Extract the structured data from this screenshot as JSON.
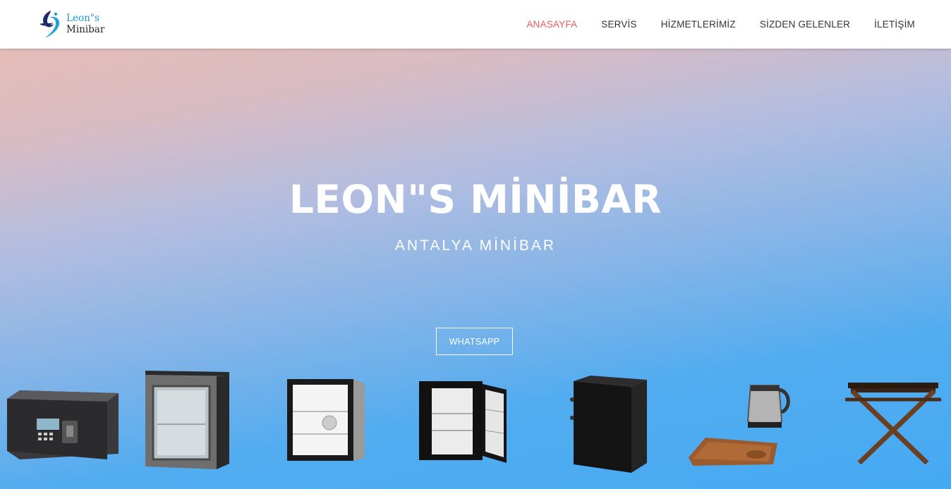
{
  "brand": {
    "line1": "Leon\"s",
    "line2": "Minibar"
  },
  "nav": {
    "items": [
      {
        "label": "ANASAYFA",
        "active": true
      },
      {
        "label": "SERVİS",
        "active": false
      },
      {
        "label": "HİZMETLERİMİZ",
        "active": false
      },
      {
        "label": "SİZDEN GELENLER",
        "active": false
      },
      {
        "label": "İLETİŞİM",
        "active": false
      }
    ]
  },
  "hero": {
    "title": "LEON\"S MİNİBAR",
    "subtitle": "ANTALYA MİNİBAR",
    "button_label": "WHATSAPP"
  },
  "colors": {
    "accent": "#f05a5a",
    "hero_top": "#e4bcb7",
    "hero_bottom": "#45aaf2",
    "nav_text": "#333333"
  },
  "products": [
    {
      "icon": "safe-box-icon"
    },
    {
      "icon": "glass-door-minibar-icon"
    },
    {
      "icon": "open-minibar-white-icon"
    },
    {
      "icon": "open-minibar-black-icon"
    },
    {
      "icon": "closed-minibar-icon"
    },
    {
      "icon": "kettle-tray-icon"
    },
    {
      "icon": "luggage-rack-icon"
    }
  ]
}
